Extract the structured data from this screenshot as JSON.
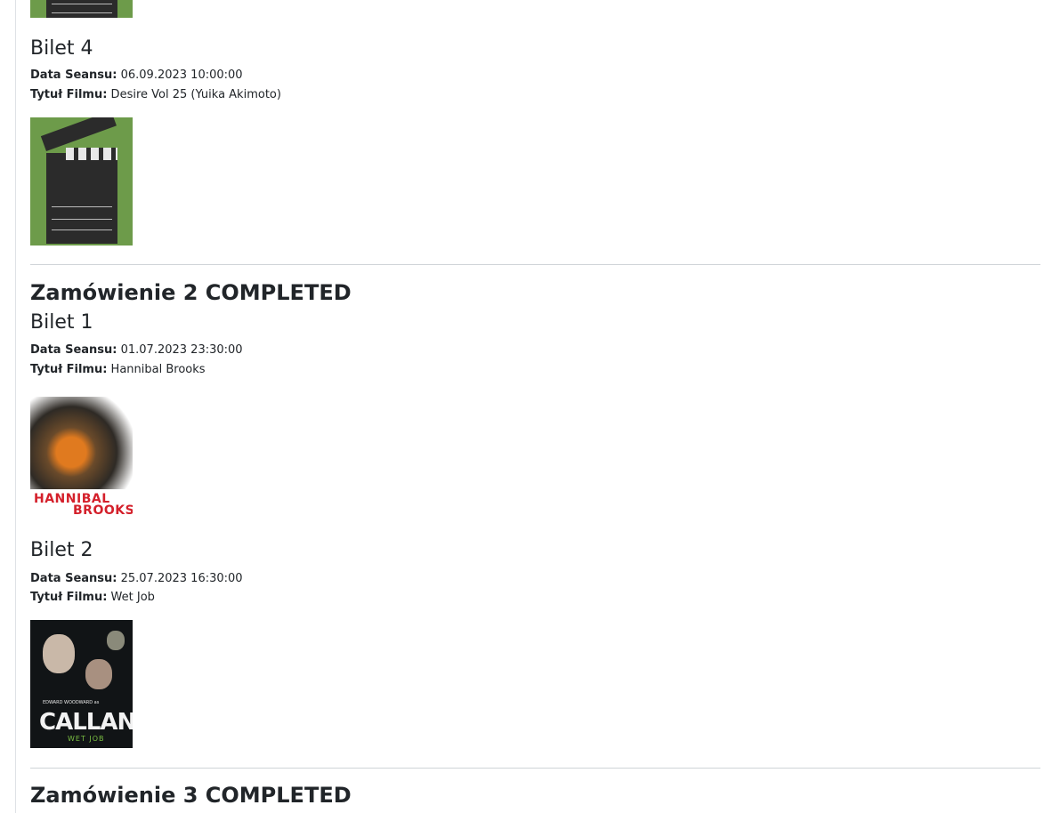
{
  "labels": {
    "date": "Data Seansu:",
    "film": "Tytuł Filmu:"
  },
  "order1": {
    "ticket4": {
      "title": "Bilet 4",
      "date": " 06.09.2023 10:00:00",
      "film": " Desire Vol 25 (Yuika Akimoto)",
      "poster": "clapperboard-poster"
    }
  },
  "order2": {
    "title": "Zamówienie 2 COMPLETED",
    "ticket1": {
      "title": "Bilet 1",
      "date": " 01.07.2023 23:30:00",
      "film": " Hannibal Brooks",
      "poster": "hannibal-brooks-poster",
      "poster_text": [
        "HANNIBAL",
        "BROOKS"
      ]
    },
    "ticket2": {
      "title": "Bilet 2",
      "date": " 25.07.2023 16:30:00",
      "film": " Wet Job",
      "poster": "callan-wet-job-poster",
      "poster_text": {
        "actor": "EDWARD WOODWARD as",
        "title": "CALLAN",
        "subtitle": "WET JOB"
      }
    }
  },
  "order3": {
    "title": "Zamówienie 3 COMPLETED"
  }
}
